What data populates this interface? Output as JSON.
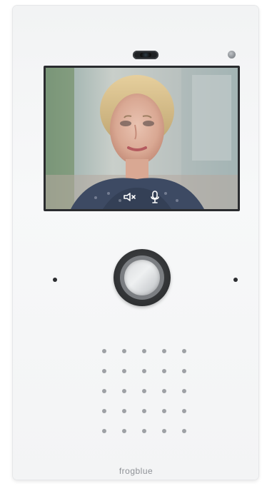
{
  "brand": {
    "text": "frogblue"
  },
  "device": {
    "body_color": "#f4f5f6",
    "button_color": "#2f3133"
  },
  "screen": {
    "content": "video-feed-person",
    "controls": [
      {
        "icon": "speaker-muted-icon",
        "active": false
      },
      {
        "icon": "microphone-icon",
        "active": true
      }
    ]
  },
  "indicators": {
    "camera": "camera-lens-icon",
    "led": "status-led"
  }
}
